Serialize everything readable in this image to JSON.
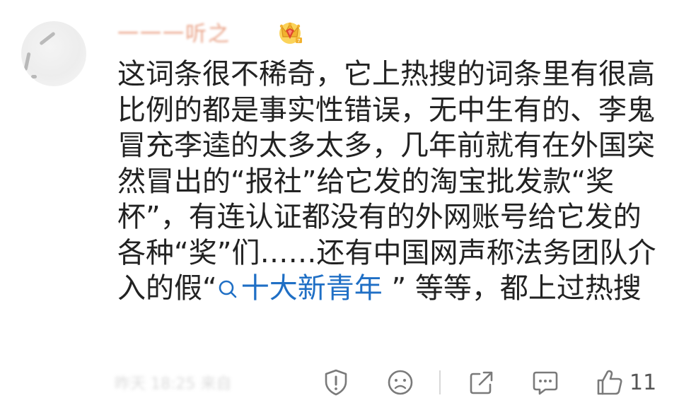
{
  "comment": {
    "username": "一一一听之",
    "badge_icon": "crown-badge-icon",
    "body_segments": [
      "这词条很不稀奇，它上热搜的词条里有很高比例的都是事实性错误，无中生有的、李鬼冒充李逵的太多太多，几年前就有在外国突然冒出的“报社”给它发的淘宝批发款“奖杯”，有连认证都没有的外网账号给它发的各种“奖”们……还有中国网声称法务团队介入的假“",
      "十大新青年",
      " ” 等等，都上过热搜"
    ],
    "topic_link_icon": "search-icon",
    "meta_text": "昨天 18:25 来自",
    "actions": {
      "report_icon": "warning-shield-icon",
      "dislike_icon": "sad-face-icon",
      "share_icon": "share-icon",
      "reply_icon": "comment-bubble-icon",
      "like_icon": "thumbs-up-icon",
      "like_count": "11"
    },
    "colors": {
      "text": "#222222",
      "link": "#1f6fc5",
      "icon": "#7a7a7a",
      "badge_gold": "#f2b230",
      "badge_red": "#e0452e"
    }
  }
}
